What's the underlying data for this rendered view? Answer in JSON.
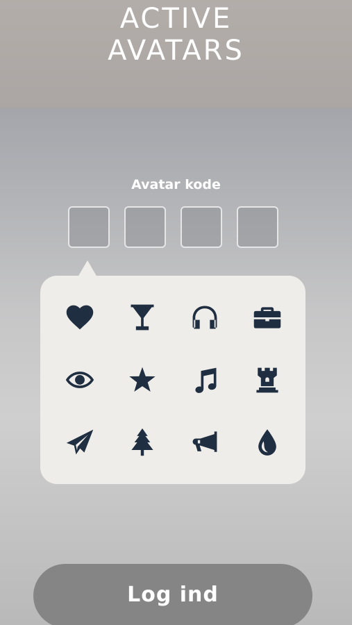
{
  "app": {
    "title_line1": "ACTIVE",
    "title_line2": "AVATARS"
  },
  "login": {
    "code_label": "Avatar kode",
    "code_slots": [
      "",
      "",
      "",
      ""
    ],
    "submit_label": "Log ind"
  },
  "icon_picker": {
    "icons": [
      "heart-icon",
      "cocktail-glass-icon",
      "headphones-icon",
      "briefcase-icon",
      "eye-icon",
      "star-icon",
      "music-note-icon",
      "chess-rook-icon",
      "paper-plane-icon",
      "tree-icon",
      "megaphone-icon",
      "water-drop-icon"
    ],
    "icon_color": "#1f2e40",
    "background_color": "#efede9"
  },
  "colors": {
    "button_bg": "#858585",
    "text_on_bg": "#ffffff"
  }
}
